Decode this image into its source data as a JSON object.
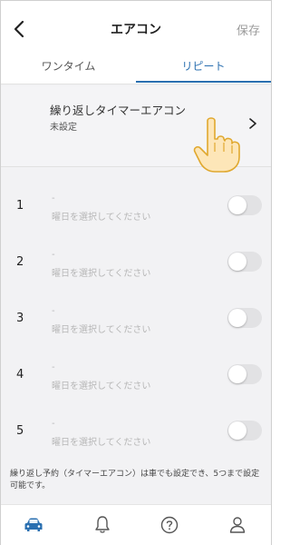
{
  "header": {
    "title": "エアコン",
    "save_label": "保存"
  },
  "tabs": [
    {
      "label": "ワンタイム",
      "active": false
    },
    {
      "label": "リピート",
      "active": true
    }
  ],
  "repeat_timer": {
    "title": "繰り返しタイマーエアコン",
    "status": "未設定"
  },
  "slots": [
    {
      "number": "1",
      "time": "-",
      "days": "曜日を選択してください",
      "enabled": false
    },
    {
      "number": "2",
      "time": "-",
      "days": "曜日を選択してください",
      "enabled": false
    },
    {
      "number": "3",
      "time": "-",
      "days": "曜日を選択してください",
      "enabled": false
    },
    {
      "number": "4",
      "time": "-",
      "days": "曜日を選択してください",
      "enabled": false
    },
    {
      "number": "5",
      "time": "-",
      "days": "曜日を選択してください",
      "enabled": false
    }
  ],
  "footnote": "繰り返し予約（タイマーエアコン）は車でも設定でき、5つまで設定可能です。",
  "bottom_nav": [
    {
      "icon": "car-icon",
      "active": true
    },
    {
      "icon": "bell-icon",
      "active": false
    },
    {
      "icon": "help-icon",
      "active": false
    },
    {
      "icon": "person-icon",
      "active": false
    }
  ],
  "colors": {
    "accent": "#2a6fb0",
    "toggle_off": "#e2e2e4",
    "hand_fill": "#fde6b8",
    "hand_outline": "#e0a82e"
  }
}
